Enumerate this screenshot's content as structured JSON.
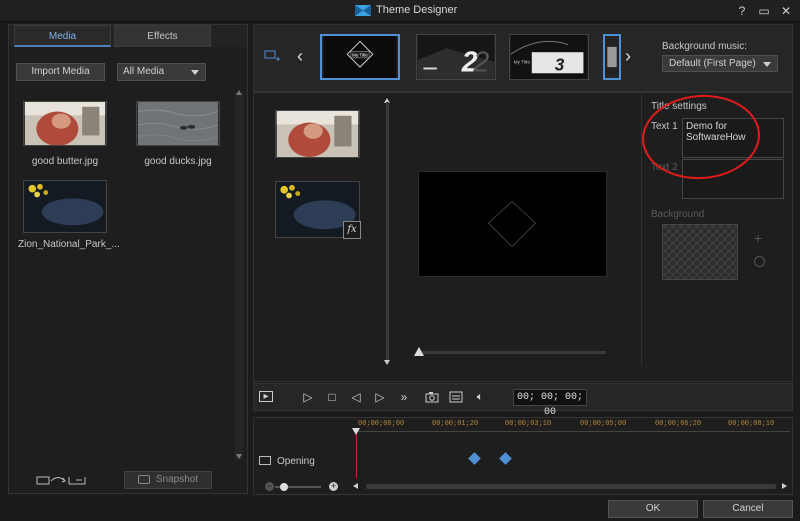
{
  "window": {
    "title": "Theme Designer",
    "controls": [
      "?",
      "▭",
      "✕"
    ]
  },
  "left_panel": {
    "tabs": [
      {
        "label": "Media",
        "active": true
      },
      {
        "label": "Effects",
        "active": false
      }
    ],
    "import_label": "Import Media",
    "filter_value": "All Media",
    "items": [
      {
        "label": "good butter.jpg"
      },
      {
        "label": "good ducks.jpg"
      },
      {
        "label": "Zion_National_Park_..."
      }
    ],
    "snapshot_label": "Snapshot"
  },
  "templates": {
    "items": [
      "My Title",
      "2",
      "3"
    ],
    "bg_music_label": "Background music:",
    "bg_music_value": "Default (First Page)"
  },
  "scene_list": {
    "fx_label": "fx"
  },
  "title_settings": {
    "heading": "Title settings",
    "text1_label": "Text 1",
    "text1_value": "Demo for\nSoftwareHow",
    "text2_label": "Text 2",
    "text2_value": "",
    "background_label": "Background"
  },
  "playback": {
    "timecode": "00; 00; 00; 00"
  },
  "timeline": {
    "ruler": [
      "00;00;00;00",
      "00;00;01;20",
      "00;00;03;10",
      "00;00;05;00",
      "00;00;06;20",
      "00;00;08;10"
    ],
    "track_label": "Opening"
  },
  "footer": {
    "ok_label": "OK",
    "cancel_label": "Cancel"
  },
  "colors": {
    "accent": "#4f8fd4",
    "annotation": "#e01b1b",
    "timecode_ruler": "#b48a3c"
  }
}
